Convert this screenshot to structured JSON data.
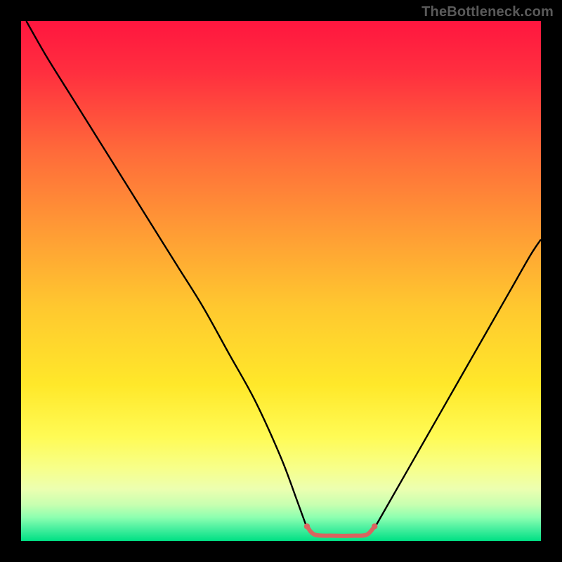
{
  "watermark": {
    "text": "TheBottleneck.com"
  },
  "chart_data": {
    "type": "line",
    "title": "",
    "xlabel": "",
    "ylabel": "",
    "xlim": [
      0,
      100
    ],
    "ylim": [
      0,
      100
    ],
    "grid": false,
    "legend": false,
    "background_gradient_stops": [
      {
        "offset": 0.0,
        "color": "#ff163f"
      },
      {
        "offset": 0.1,
        "color": "#ff2f3f"
      },
      {
        "offset": 0.25,
        "color": "#ff6a3a"
      },
      {
        "offset": 0.4,
        "color": "#ff9a35"
      },
      {
        "offset": 0.55,
        "color": "#ffc82f"
      },
      {
        "offset": 0.7,
        "color": "#ffe82a"
      },
      {
        "offset": 0.8,
        "color": "#fffb55"
      },
      {
        "offset": 0.86,
        "color": "#f7ff8a"
      },
      {
        "offset": 0.9,
        "color": "#ecffb0"
      },
      {
        "offset": 0.93,
        "color": "#c8ffb0"
      },
      {
        "offset": 0.955,
        "color": "#8cffb0"
      },
      {
        "offset": 0.975,
        "color": "#4cf0a0"
      },
      {
        "offset": 1.0,
        "color": "#00e084"
      }
    ],
    "series": [
      {
        "name": "left-curve",
        "stroke": "#000000",
        "stroke_width": 2.4,
        "x": [
          1,
          5,
          10,
          15,
          20,
          25,
          30,
          35,
          40,
          45,
          50,
          53,
          55
        ],
        "y": [
          100,
          93,
          85,
          77,
          69,
          61,
          53,
          45,
          36,
          27,
          16,
          8,
          2.5
        ]
      },
      {
        "name": "right-curve",
        "stroke": "#000000",
        "stroke_width": 2.4,
        "x": [
          68,
          70,
          74,
          78,
          82,
          86,
          90,
          94,
          98,
          100
        ],
        "y": [
          2.5,
          6,
          13,
          20,
          27,
          34,
          41,
          48,
          55,
          58
        ]
      },
      {
        "name": "bottom-highlight",
        "stroke": "#d9645f",
        "stroke_width": 6,
        "linecap": "round",
        "x": [
          55,
          56.5,
          60,
          64,
          66.5,
          68
        ],
        "y": [
          2.8,
          1.2,
          1.0,
          1.0,
          1.2,
          2.8
        ]
      }
    ],
    "highlight_endpoints": {
      "color": "#d9645f",
      "radius": 4.2,
      "points": [
        {
          "x": 55,
          "y": 2.8
        },
        {
          "x": 68,
          "y": 2.8
        }
      ]
    }
  }
}
